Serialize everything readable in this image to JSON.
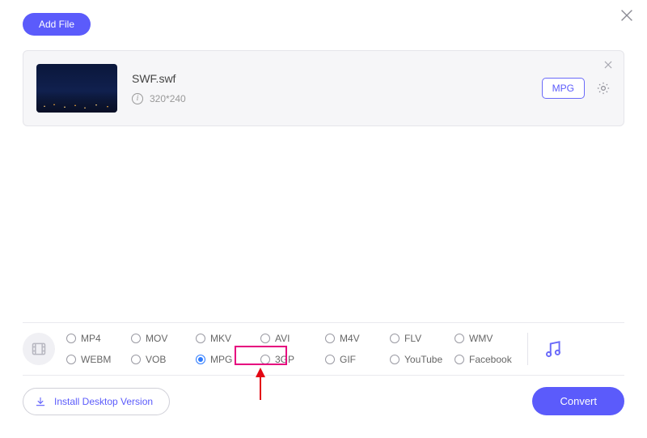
{
  "toolbar": {
    "add_file_label": "Add File"
  },
  "file": {
    "name": "SWF.swf",
    "resolution": "320*240",
    "selected_output": "MPG"
  },
  "formats": {
    "options": [
      "MP4",
      "MOV",
      "MKV",
      "AVI",
      "M4V",
      "FLV",
      "WMV",
      "WEBM",
      "VOB",
      "MPG",
      "3GP",
      "GIF",
      "YouTube",
      "Facebook"
    ],
    "selected": "MPG"
  },
  "footer": {
    "install_label": "Install Desktop Version",
    "convert_label": "Convert"
  }
}
